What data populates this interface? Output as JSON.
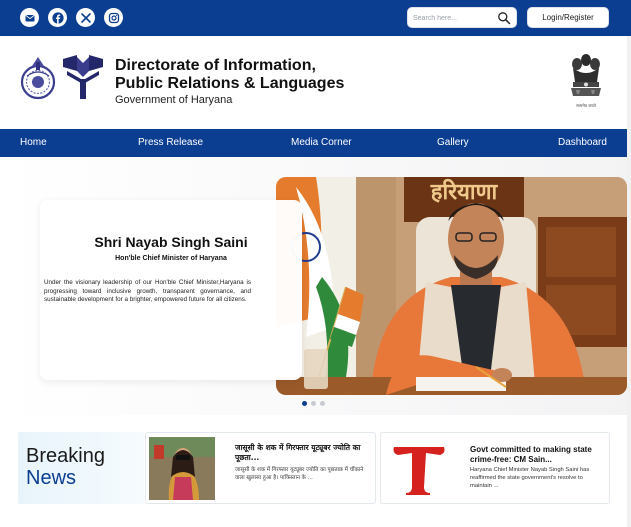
{
  "topbar": {
    "social": [
      {
        "name": "email-icon"
      },
      {
        "name": "facebook-icon"
      },
      {
        "name": "x-icon"
      },
      {
        "name": "instagram-icon"
      }
    ],
    "search_placeholder": "Search here...",
    "login_label": "Login/Register",
    "brand_color": "#0b3d91"
  },
  "header": {
    "title_line1": "Directorate of Information,",
    "title_line2": "Public Relations & Languages",
    "subtitle": "Government of Haryana",
    "emblem_caption": "सत्यमेव जयते"
  },
  "nav": {
    "items": [
      "Home",
      "Press Release",
      "Media Corner",
      "Gallery",
      "Dashboard"
    ]
  },
  "hero": {
    "name": "Shri Nayab Singh Saini",
    "role": "Hon'ble Chief Minister of Haryana",
    "description": "Under the visionary leadership of our Hon'ble Chief Minister,Haryana is progressing toward inclusive growth, transparent governance, and sustainable development for a brighter, empowered future for all citizens.",
    "wall_text": "हरियाणा",
    "active_slide": 1,
    "slide_count": 3
  },
  "breaking": {
    "word1": "Breaking",
    "word2": "News",
    "items": [
      {
        "headline": "जासूसी के शक में गिरफ्तार यूट्यूबर ज्योति का पूछता...",
        "summary": "जासूसी के शक में गिरफ्तार यूट्यूबर ज्योति का पूछताछ में चौंकाने वाला खुलासा हुआ है। पाकिस्तान के ..."
      },
      {
        "headline": "Govt committed to making state crime-free: CM Sain...",
        "summary": "Haryana Chief Minister Nayab Singh Saini has reaffirmed the state government's resolve to maintain ..."
      }
    ]
  }
}
